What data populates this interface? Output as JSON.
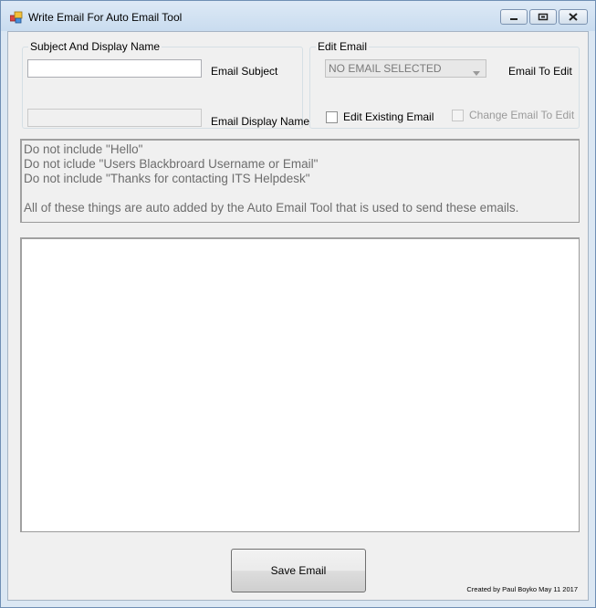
{
  "window": {
    "title": "Write Email For Auto Email Tool"
  },
  "subject_group": {
    "legend": "Subject And Display Name",
    "subject_label": "Email Subject",
    "display_name_label": "Email Display Name",
    "subject_value": "",
    "display_name_value": ""
  },
  "edit_group": {
    "legend": "Edit Email",
    "combo_value": "NO EMAIL SELECTED",
    "email_to_edit_label": "Email To Edit",
    "edit_existing_label": "Edit Existing Email",
    "change_email_label": "Change Email To Edit"
  },
  "notes": {
    "lines": [
      "Do not include \"Hello\"",
      "Do not iclude \"Users Blackbroard Username or Email\"",
      "Do not include \"Thanks for contacting ITS Helpdesk\"",
      "",
      "All of these things are auto added by the Auto Email Tool that is used to send these emails."
    ]
  },
  "email_body": {
    "value": ""
  },
  "footer": {
    "save_label": "Save Email",
    "credit": "Created by Paul Boyko May 11 2017"
  },
  "colors": {
    "titlebar": "#c9dcef",
    "client_bg": "#f0f0f0",
    "disabled_text": "#8d8d8d"
  },
  "icons": [
    "app-icon",
    "minimize-icon",
    "maximize-icon",
    "close-icon",
    "dropdown-arrow-icon"
  ]
}
